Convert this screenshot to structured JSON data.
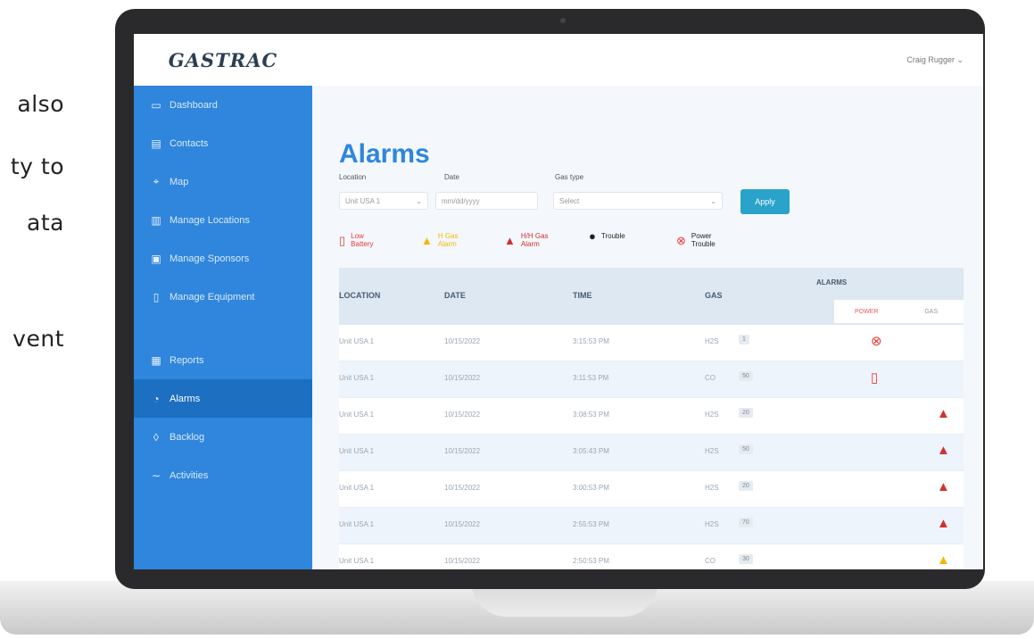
{
  "side_text": [
    "also",
    "ty to",
    "ata",
    "vent"
  ],
  "logo": "GASTRAC",
  "user_menu": "Craig Rugger ⌄",
  "sidebar": {
    "items": [
      {
        "label": "Dashboard",
        "icon": "monitor-icon"
      },
      {
        "label": "Contacts",
        "icon": "address-book-icon"
      },
      {
        "label": "Map",
        "icon": "map-icon"
      },
      {
        "label": "Manage Locations",
        "icon": "building-icon"
      },
      {
        "label": "Manage Sponsors",
        "icon": "briefcase-icon"
      },
      {
        "label": "Manage Equipment",
        "icon": "cylinder-icon"
      },
      {
        "label": "Reports",
        "icon": "report-icon"
      },
      {
        "label": "Alarms",
        "icon": "bell-icon",
        "active": true
      },
      {
        "label": "Backlog",
        "icon": "clipboard-icon"
      },
      {
        "label": "Activities",
        "icon": "activity-icon"
      }
    ]
  },
  "page": {
    "title": "Alarms",
    "filters": {
      "location_label": "Location",
      "location_value": "Unit USA 1",
      "date_label": "Date",
      "date_placeholder": "mm/dd/yyyy",
      "gas_type_label": "Gas type",
      "gas_type_value": "Select",
      "apply_label": "Apply"
    },
    "legend": [
      {
        "label": "Low Battery",
        "color": "#e53935",
        "icon": "battery-icon"
      },
      {
        "label": "H Gas Alarm",
        "color": "#f5b800",
        "icon": "alarm-icon"
      },
      {
        "label": "H/H Gas Alarm",
        "color": "#d32f2f",
        "icon": "alarm-icon"
      },
      {
        "label": "Trouble",
        "color": "#222222",
        "icon": "trouble-icon"
      },
      {
        "label": "Power Trouble",
        "color": "#e53935",
        "icon": "power-icon"
      }
    ]
  },
  "table": {
    "headers": {
      "location": "LOCATION",
      "date": "DATE",
      "time": "TIME",
      "gas": "GAS",
      "alarms": "ALARMS"
    },
    "tabs": [
      "POWER",
      "GAS"
    ],
    "rows": [
      {
        "location": "Unit USA 1",
        "date": "10/15/2022",
        "time": "3:15:53 PM",
        "gas": "H2S",
        "level": "1",
        "alarm_icon": "power-icon",
        "alarm_color": "#e53935",
        "alarm_col": "power"
      },
      {
        "location": "Unit USA 1",
        "date": "10/15/2022",
        "time": "3:11:53 PM",
        "gas": "CO",
        "level": "50",
        "alarm_icon": "battery-icon",
        "alarm_color": "#e53935",
        "alarm_col": "power"
      },
      {
        "location": "Unit USA 1",
        "date": "10/15/2022",
        "time": "3:08:53 PM",
        "gas": "H2S",
        "level": "20",
        "alarm_icon": "alarm-icon",
        "alarm_color": "#d32f2f",
        "alarm_col": "gas"
      },
      {
        "location": "Unit USA 1",
        "date": "10/15/2022",
        "time": "3:05:43 PM",
        "gas": "H2S",
        "level": "50",
        "alarm_icon": "alarm-icon",
        "alarm_color": "#d32f2f",
        "alarm_col": "gas"
      },
      {
        "location": "Unit USA 1",
        "date": "10/15/2022",
        "time": "3:00:53 PM",
        "gas": "H2S",
        "level": "20",
        "alarm_icon": "alarm-icon",
        "alarm_color": "#d32f2f",
        "alarm_col": "gas"
      },
      {
        "location": "Unit USA 1",
        "date": "10/15/2022",
        "time": "2:55:53 PM",
        "gas": "H2S",
        "level": "70",
        "alarm_icon": "alarm-icon",
        "alarm_color": "#d32f2f",
        "alarm_col": "gas"
      },
      {
        "location": "Unit USA 1",
        "date": "10/15/2022",
        "time": "2:50:53 PM",
        "gas": "CO",
        "level": "30",
        "alarm_icon": "alarm-icon",
        "alarm_color": "#f5b800",
        "alarm_col": "gas"
      }
    ]
  }
}
